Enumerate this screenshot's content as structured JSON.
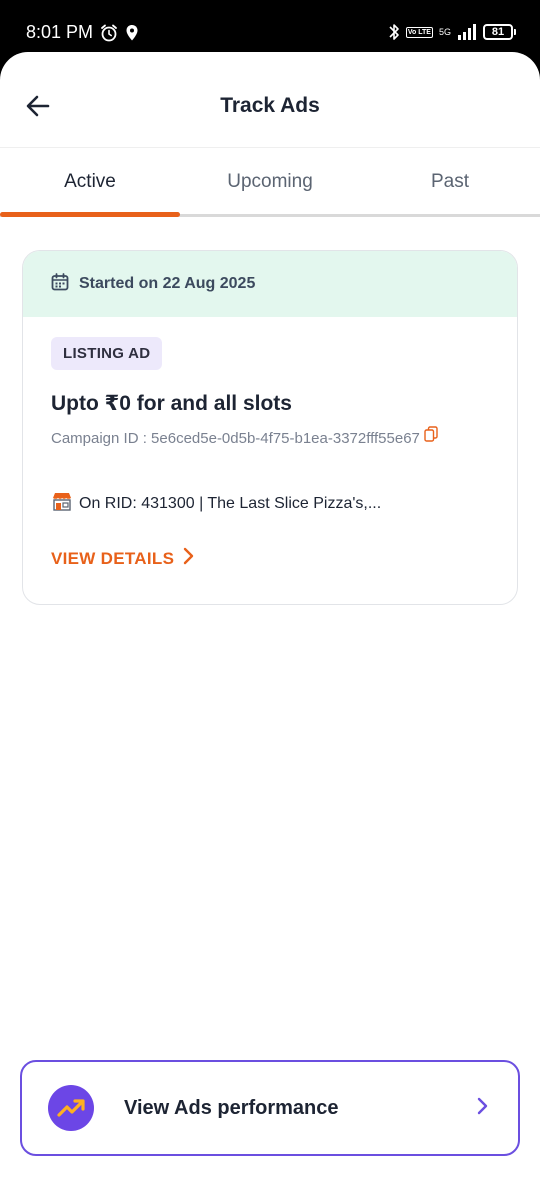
{
  "status_bar": {
    "time": "8:01 PM",
    "network_type": "5G",
    "lte_label": "Vo LTE",
    "battery_level": "81",
    "icons": [
      "alarm-icon",
      "location-icon",
      "bluetooth-icon",
      "signal-icon",
      "battery-icon"
    ]
  },
  "header": {
    "title": "Track Ads",
    "back_icon": "arrow-left-icon"
  },
  "tabs": [
    {
      "label": "Active",
      "active": true
    },
    {
      "label": "Upcoming",
      "active": false
    },
    {
      "label": "Past",
      "active": false
    }
  ],
  "ad_card": {
    "started_text": "Started on 22 Aug 2025",
    "badge": "LISTING AD",
    "headline": "Upto ₹0  for  and all slots",
    "campaign_id": "Campaign ID : 5e6ced5e-0d5b-4f75-b1ea-3372fff55e67",
    "rid_text": "On RID: 431300 | The Last Slice Pizza's,...",
    "view_details": "VIEW DETAILS"
  },
  "performance_button": {
    "label": "View Ads performance",
    "icon": "trending-up-icon"
  },
  "colors": {
    "accent_orange": "#e8611a",
    "accent_purple": "#6c46e6",
    "card_header_green": "#e3f7ee",
    "badge_lavender": "#ede9fb"
  }
}
